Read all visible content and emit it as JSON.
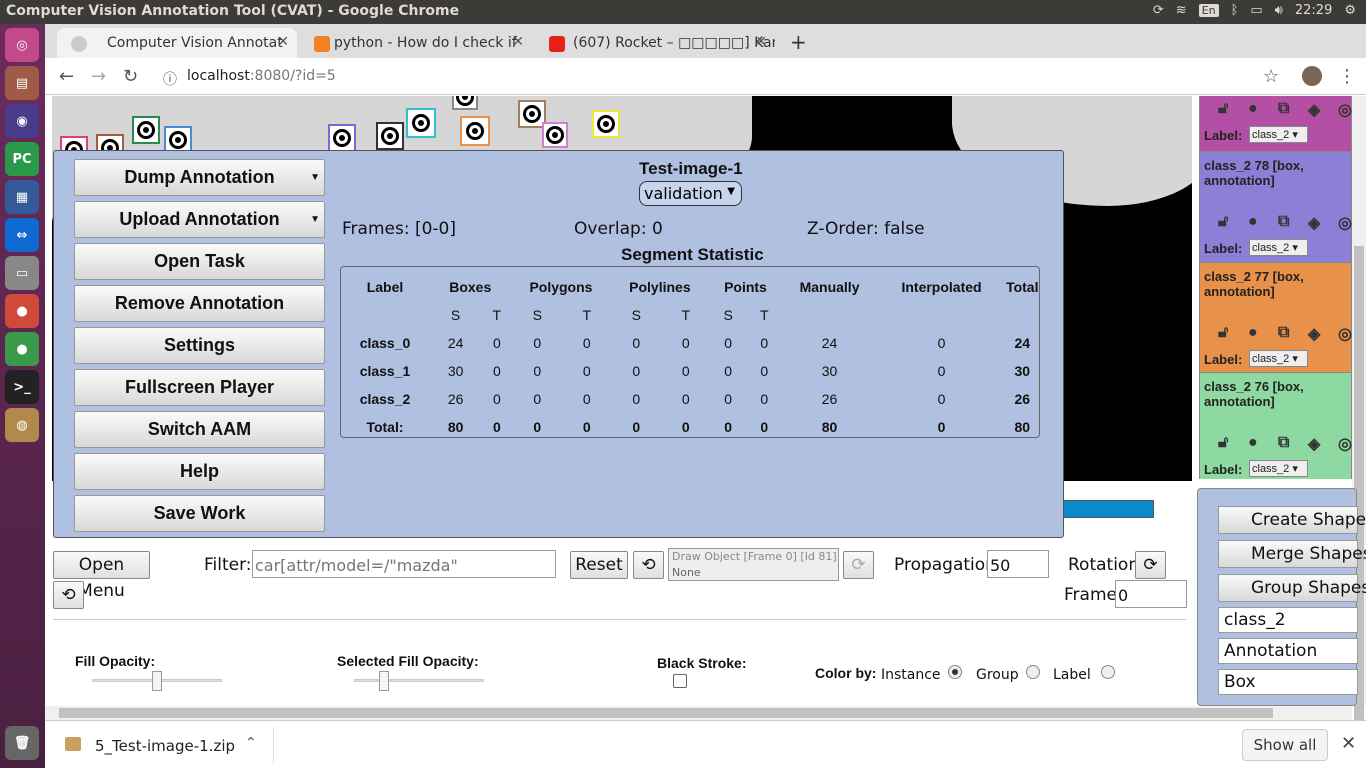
{
  "os": {
    "window_title": "Computer Vision Annotation Tool (CVAT) - Google Chrome",
    "keyboard_layout": "En",
    "clock": "22:29"
  },
  "browser": {
    "tabs": [
      {
        "label": "Computer Vision Annotat",
        "active": true
      },
      {
        "label": "python - How do I check if",
        "active": false
      },
      {
        "label": "(607) Rocket – □□□□□] Kann",
        "active": false
      }
    ],
    "url_host": "localhost",
    "url_rest": ":8080/?id=5"
  },
  "menu": {
    "buttons": {
      "dump": "Dump Annotation",
      "upload": "Upload Annotation",
      "open_task": "Open Task",
      "remove": "Remove Annotation",
      "settings": "Settings",
      "fullscreen": "Fullscreen Player",
      "switch_aam": "Switch AAM",
      "help": "Help",
      "save": "Save Work"
    },
    "task_name": "Test-image-1",
    "mode": "validation",
    "frames": "Frames: [0-0]",
    "overlap": "Overlap: 0",
    "zorder": "Z-Order: false",
    "segment_title": "Segment Statistic",
    "stats": {
      "headers": [
        "Label",
        "Boxes",
        "Polygons",
        "Polylines",
        "Points",
        "Manually",
        "Interpolated",
        "Total"
      ],
      "subheaders": [
        "S",
        "T",
        "S",
        "T",
        "S",
        "T",
        "S",
        "T"
      ],
      "rows": [
        [
          "class_0",
          "24",
          "0",
          "0",
          "0",
          "0",
          "0",
          "0",
          "0",
          "24",
          "0",
          "24"
        ],
        [
          "class_1",
          "30",
          "0",
          "0",
          "0",
          "0",
          "0",
          "0",
          "0",
          "30",
          "0",
          "30"
        ],
        [
          "class_2",
          "26",
          "0",
          "0",
          "0",
          "0",
          "0",
          "0",
          "0",
          "26",
          "0",
          "26"
        ],
        [
          "Total:",
          "80",
          "0",
          "0",
          "0",
          "0",
          "0",
          "0",
          "0",
          "80",
          "0",
          "80"
        ]
      ]
    }
  },
  "objects": [
    {
      "title": "",
      "label_text": "Label:",
      "value": "class_2",
      "color": "#b34fa4"
    },
    {
      "title": "class_2 78 [box, annotation]",
      "label_text": "Label:",
      "value": "class_2",
      "color": "#8b80d6"
    },
    {
      "title": "class_2 77 [box, annotation]",
      "label_text": "Label:",
      "value": "class_2",
      "color": "#e8914a"
    },
    {
      "title": "class_2 76 [box, annotation]",
      "label_text": "Label:",
      "value": "class_2",
      "color": "#8ed9a2"
    }
  ],
  "right_panel": {
    "create": "Create Shape",
    "merge": "Merge Shapes",
    "group": "Group Shapes",
    "label_select": "class_2",
    "mode_select": "Annotation",
    "shape_select": "Box"
  },
  "controls": {
    "open_menu": "Open Menu",
    "filter_label": "Filter:",
    "filter_placeholder": "car[attr/model=/\"mazda\"",
    "reset": "Reset",
    "draw_object_line1": "Draw Object [Frame 0] [Id 81]",
    "draw_object_line2": "None",
    "propagation_label": "Propagation",
    "propagation_value": "50",
    "rotation_label": "Rotation",
    "frame_label": "Frame",
    "frame_value": "0"
  },
  "settings": {
    "fill_opacity": "Fill Opacity:",
    "selected_fill_opacity": "Selected Fill Opacity:",
    "black_stroke": "Black Stroke:",
    "color_by": "Color by:",
    "instance": "Instance",
    "group": "Group",
    "label": "Label"
  },
  "downloads": {
    "file": "5_Test-image-1.zip",
    "show_all": "Show all"
  }
}
